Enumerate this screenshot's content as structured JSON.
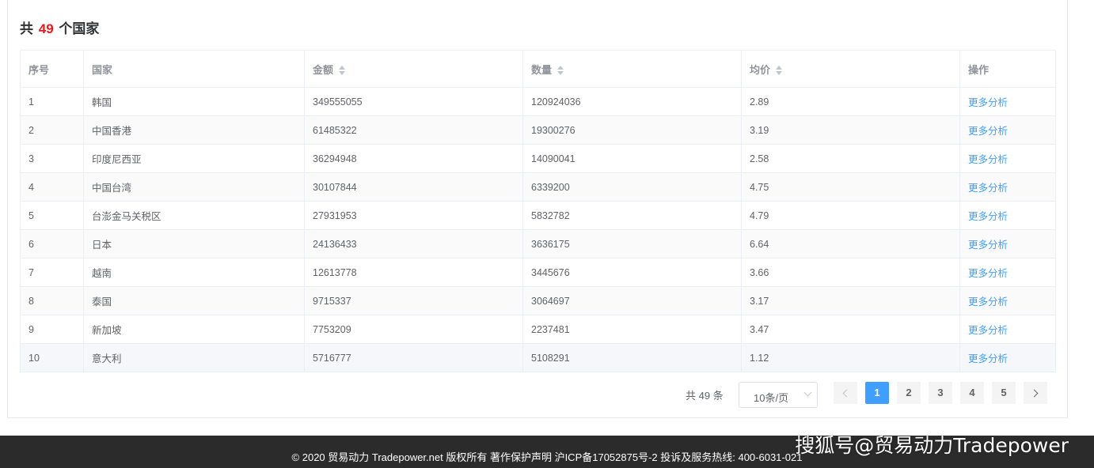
{
  "header": {
    "prefix": "共",
    "count": "49",
    "suffix": "个国家"
  },
  "table": {
    "columns": [
      {
        "label": "序号",
        "sortable": false
      },
      {
        "label": "国家",
        "sortable": false
      },
      {
        "label": "金额",
        "sortable": true
      },
      {
        "label": "数量",
        "sortable": true
      },
      {
        "label": "均价",
        "sortable": true
      },
      {
        "label": "操作",
        "sortable": false
      }
    ],
    "rows": [
      {
        "idx": "1",
        "country": "韩国",
        "amount": "349555055",
        "qty": "120924036",
        "price": "2.89",
        "action": "更多分析"
      },
      {
        "idx": "2",
        "country": "中国香港",
        "amount": "61485322",
        "qty": "19300276",
        "price": "3.19",
        "action": "更多分析"
      },
      {
        "idx": "3",
        "country": "印度尼西亚",
        "amount": "36294948",
        "qty": "14090041",
        "price": "2.58",
        "action": "更多分析"
      },
      {
        "idx": "4",
        "country": "中国台湾",
        "amount": "30107844",
        "qty": "6339200",
        "price": "4.75",
        "action": "更多分析"
      },
      {
        "idx": "5",
        "country": "台澎金马关税区",
        "amount": "27931953",
        "qty": "5832782",
        "price": "4.79",
        "action": "更多分析"
      },
      {
        "idx": "6",
        "country": "日本",
        "amount": "24136433",
        "qty": "3636175",
        "price": "6.64",
        "action": "更多分析"
      },
      {
        "idx": "7",
        "country": "越南",
        "amount": "12613778",
        "qty": "3445676",
        "price": "3.66",
        "action": "更多分析"
      },
      {
        "idx": "8",
        "country": "泰国",
        "amount": "9715337",
        "qty": "3064697",
        "price": "3.17",
        "action": "更多分析"
      },
      {
        "idx": "9",
        "country": "新加坡",
        "amount": "7753209",
        "qty": "2237481",
        "price": "3.47",
        "action": "更多分析"
      },
      {
        "idx": "10",
        "country": "意大利",
        "amount": "5716777",
        "qty": "5108291",
        "price": "1.12",
        "action": "更多分析"
      }
    ]
  },
  "pagination": {
    "total_text": "共 49 条",
    "page_size": "10条/页",
    "pages": [
      "1",
      "2",
      "3",
      "4",
      "5"
    ],
    "current": "1"
  },
  "footer": {
    "text": "© 2020 贸易动力 Tradepower.net 版权所有 著作保护声明 沪ICP备17052875号-2 投诉及服务热线: 400-6031-021"
  },
  "watermark": "搜狐号@贸易动力Tradepower",
  "colors": {
    "accent": "#409eff",
    "count_red": "#e6181a",
    "footer_bg": "#2b2b2b"
  }
}
